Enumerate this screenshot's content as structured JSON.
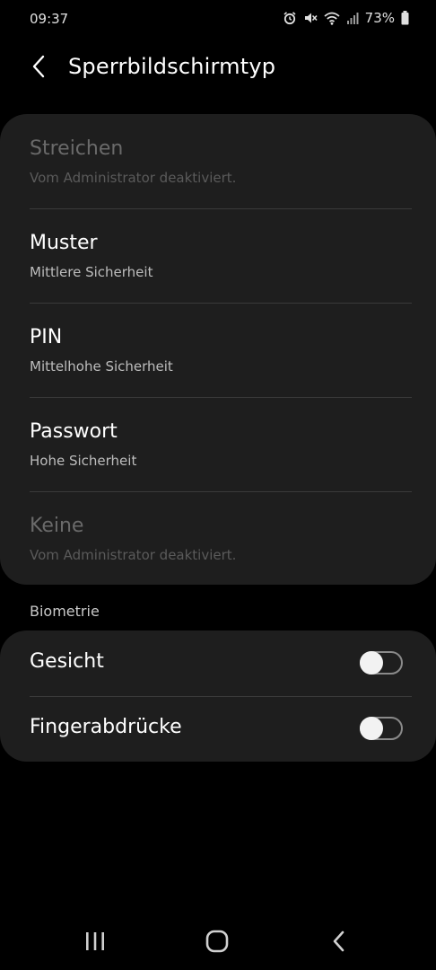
{
  "status_bar": {
    "time": "09:37",
    "battery_percent": "73%",
    "icons": [
      "alarm-icon",
      "mute-icon",
      "wifi-icon",
      "signal-icon",
      "battery-icon"
    ]
  },
  "header": {
    "title": "Sperrbildschirmtyp",
    "back_icon": "back-arrow-icon"
  },
  "lock_options": [
    {
      "title": "Streichen",
      "subtitle": "Vom Administrator deaktiviert.",
      "enabled": false
    },
    {
      "title": "Muster",
      "subtitle": "Mittlere Sicherheit",
      "enabled": true
    },
    {
      "title": "PIN",
      "subtitle": "Mittelhohe Sicherheit",
      "enabled": true
    },
    {
      "title": "Passwort",
      "subtitle": "Hohe Sicherheit",
      "enabled": true
    },
    {
      "title": "Keine",
      "subtitle": "Vom Administrator deaktiviert.",
      "enabled": false
    }
  ],
  "biometrics": {
    "section_label": "Biometrie",
    "items": [
      {
        "label": "Gesicht",
        "on": false
      },
      {
        "label": "Fingerabdrücke",
        "on": false
      }
    ]
  },
  "nav": {
    "icons": [
      "recent-apps-icon",
      "home-icon",
      "back-nav-icon"
    ]
  },
  "colors": {
    "background": "#000000",
    "card": "#1e1e1e",
    "text_primary": "#ffffff",
    "text_disabled": "#6a6a6a"
  }
}
